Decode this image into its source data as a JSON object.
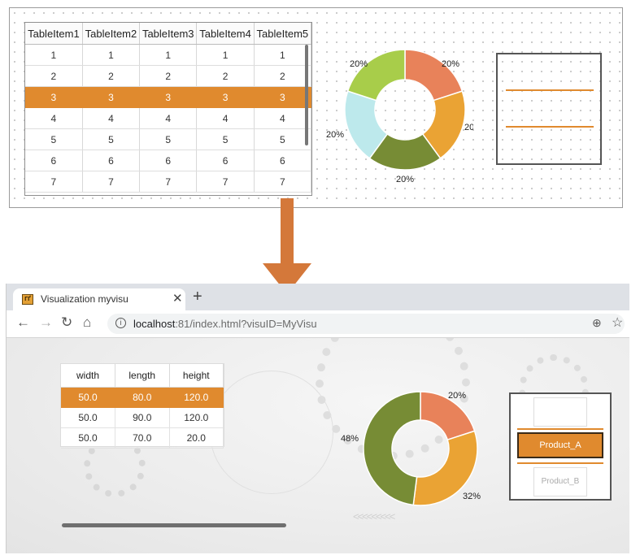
{
  "editor": {
    "table": {
      "headers": [
        "TableItem1",
        "TableItem2",
        "TableItem3",
        "TableItem4",
        "TableItem5"
      ],
      "rows": [
        [
          "1",
          "1",
          "1",
          "1",
          "1"
        ],
        [
          "2",
          "2",
          "2",
          "2",
          "2"
        ],
        [
          "3",
          "3",
          "3",
          "3",
          "3"
        ],
        [
          "4",
          "4",
          "4",
          "4",
          "4"
        ],
        [
          "5",
          "5",
          "5",
          "5",
          "5"
        ],
        [
          "6",
          "6",
          "6",
          "6",
          "6"
        ],
        [
          "7",
          "7",
          "7",
          "7",
          "7"
        ]
      ],
      "selected_row": 2
    },
    "donut": {
      "slices": [
        {
          "label": "20%",
          "value": 20,
          "color": "#e8825a"
        },
        {
          "label": "20%",
          "value": 20,
          "color": "#eaa334"
        },
        {
          "label": "20%",
          "value": 20,
          "color": "#778c35"
        },
        {
          "label": "20%",
          "value": 20,
          "color": "#bde9ec"
        },
        {
          "label": "20%",
          "value": 20,
          "color": "#a8cd4a"
        }
      ]
    }
  },
  "arrow_color": "#d4783a",
  "browser": {
    "tab_title": "Visualization myvisu",
    "favicon_text": "ГҐ",
    "url_host": "localhost",
    "url_rest": ":81/index.html?visuID=MyVisu",
    "nav": {
      "back": "←",
      "forward": "→",
      "reload": "↻",
      "home": "⌂"
    },
    "table": {
      "headers": [
        "width",
        "length",
        "height"
      ],
      "rows": [
        [
          "50.0",
          "80.0",
          "120.0"
        ],
        [
          "50.0",
          "90.0",
          "120.0"
        ],
        [
          "50.0",
          "70.0",
          "20.0"
        ]
      ],
      "selected_row": 0
    },
    "donut": {
      "slices": [
        {
          "label": "20%",
          "value": 20,
          "color": "#e8825a"
        },
        {
          "label": "32%",
          "value": 32,
          "color": "#eaa334"
        },
        {
          "label": "48%",
          "value": 48,
          "color": "#778c35"
        }
      ]
    },
    "product": {
      "selected": "Product_A",
      "below": "Product_B"
    }
  },
  "colors": {
    "accent": "#e08a2e"
  }
}
